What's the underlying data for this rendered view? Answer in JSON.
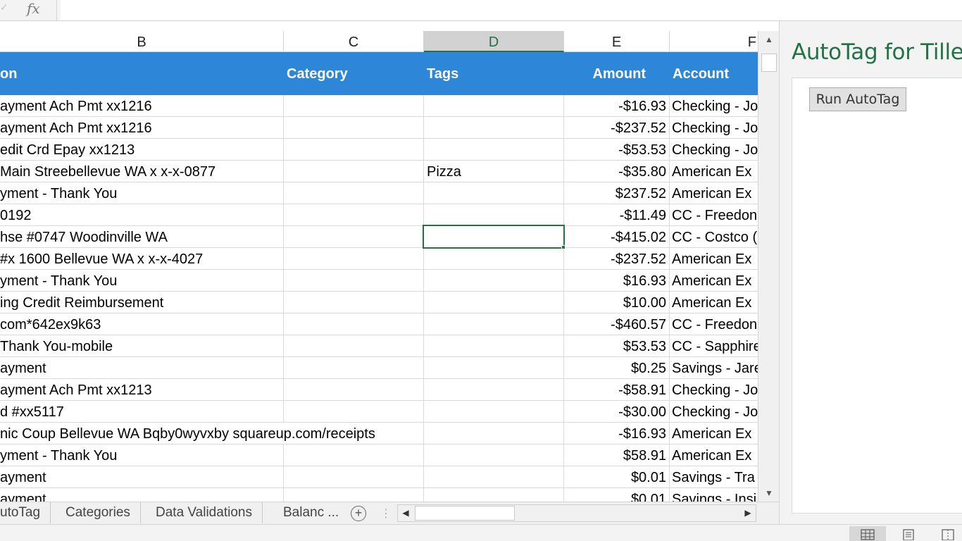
{
  "formula_bar": {
    "fx_label": "fx",
    "check_label": "✓",
    "value": ""
  },
  "columns": [
    {
      "letter": "B"
    },
    {
      "letter": "C"
    },
    {
      "letter": "D",
      "selected": true
    },
    {
      "letter": "E"
    },
    {
      "letter": "F"
    }
  ],
  "table_headers": {
    "description": "on",
    "category": "Category",
    "tags": "Tags",
    "amount": "Amount",
    "account": "Account"
  },
  "rows": [
    {
      "description": "ayment Ach Pmt xx1216",
      "category": "",
      "tags": "",
      "amount": "-$16.93",
      "account": "Checking - Jo"
    },
    {
      "description": "ayment Ach Pmt xx1216",
      "category": "",
      "tags": "",
      "amount": "-$237.52",
      "account": "Checking - Jo"
    },
    {
      "description": "edit Crd Epay xx1213",
      "category": "",
      "tags": "",
      "amount": "-$53.53",
      "account": "Checking - Jo"
    },
    {
      "description": "Main Streebellevue WA x x-x-0877",
      "category": "",
      "tags": "Pizza",
      "amount": "-$35.80",
      "account": "American Ex"
    },
    {
      "description": "yment - Thank You",
      "category": "",
      "tags": "",
      "amount": "$237.52",
      "account": "American Ex"
    },
    {
      "description": "0192",
      "category": "",
      "tags": "",
      "amount": "-$11.49",
      "account": "CC - Freedon"
    },
    {
      "description": "hse #0747 Woodinville WA",
      "category": "",
      "tags": "",
      "amount": "-$415.02",
      "account": "CC - Costco ("
    },
    {
      "description": "#x 1600 Bellevue WA x x-x-4027",
      "category": "",
      "tags": "",
      "amount": "-$237.52",
      "account": "American Ex"
    },
    {
      "description": "yment - Thank You",
      "category": "",
      "tags": "",
      "amount": "$16.93",
      "account": "American Ex"
    },
    {
      "description": "ing Credit Reimbursement",
      "category": "",
      "tags": "",
      "amount": "$10.00",
      "account": "American Ex"
    },
    {
      "description": "com*642ex9k63",
      "category": "",
      "tags": "",
      "amount": "-$460.57",
      "account": "CC - Freedon"
    },
    {
      "description": "Thank You-mobile",
      "category": "",
      "tags": "",
      "amount": "$53.53",
      "account": "CC - Sapphire"
    },
    {
      "description": "ayment",
      "category": "",
      "tags": "",
      "amount": "$0.25",
      "account": "Savings - Jare"
    },
    {
      "description": "ayment Ach Pmt xx1213",
      "category": "",
      "tags": "",
      "amount": "-$58.91",
      "account": "Checking - Jo"
    },
    {
      "description": "d #xx5117",
      "category": "",
      "tags": "",
      "amount": "-$30.00",
      "account": "Checking - Jo"
    },
    {
      "description": "nic Coup Bellevue WA Bqby0wyvxby squareup.com/receipts",
      "category": "",
      "tags": "",
      "amount": "-$16.93",
      "account": "American Ex"
    },
    {
      "description": "yment - Thank You",
      "category": "",
      "tags": "",
      "amount": "$58.91",
      "account": "American Ex"
    },
    {
      "description": "ayment",
      "category": "",
      "tags": "",
      "amount": "$0.01",
      "account": "Savings - Tra"
    },
    {
      "description": "ayment",
      "category": "",
      "tags": "",
      "amount": "$0.01",
      "account": "Savings - Insi"
    }
  ],
  "sheet_tabs": [
    {
      "label": "utoTag"
    },
    {
      "label": "Categories"
    },
    {
      "label": "Data Validations"
    },
    {
      "label": "Balanc ..."
    }
  ],
  "task_pane": {
    "title": "AutoTag for Tiller",
    "run_button": "Run AutoTag"
  },
  "colors": {
    "table_header_bg": "#2e86d9",
    "excel_green": "#217346",
    "pane_bg": "#f3f3f3"
  },
  "icons": [
    "check-icon",
    "fx-icon",
    "scroll-up-icon",
    "scroll-down-icon",
    "scroll-left-icon",
    "scroll-right-icon",
    "add-sheet-icon",
    "normal-view-icon",
    "page-layout-view-icon",
    "page-break-view-icon"
  ]
}
